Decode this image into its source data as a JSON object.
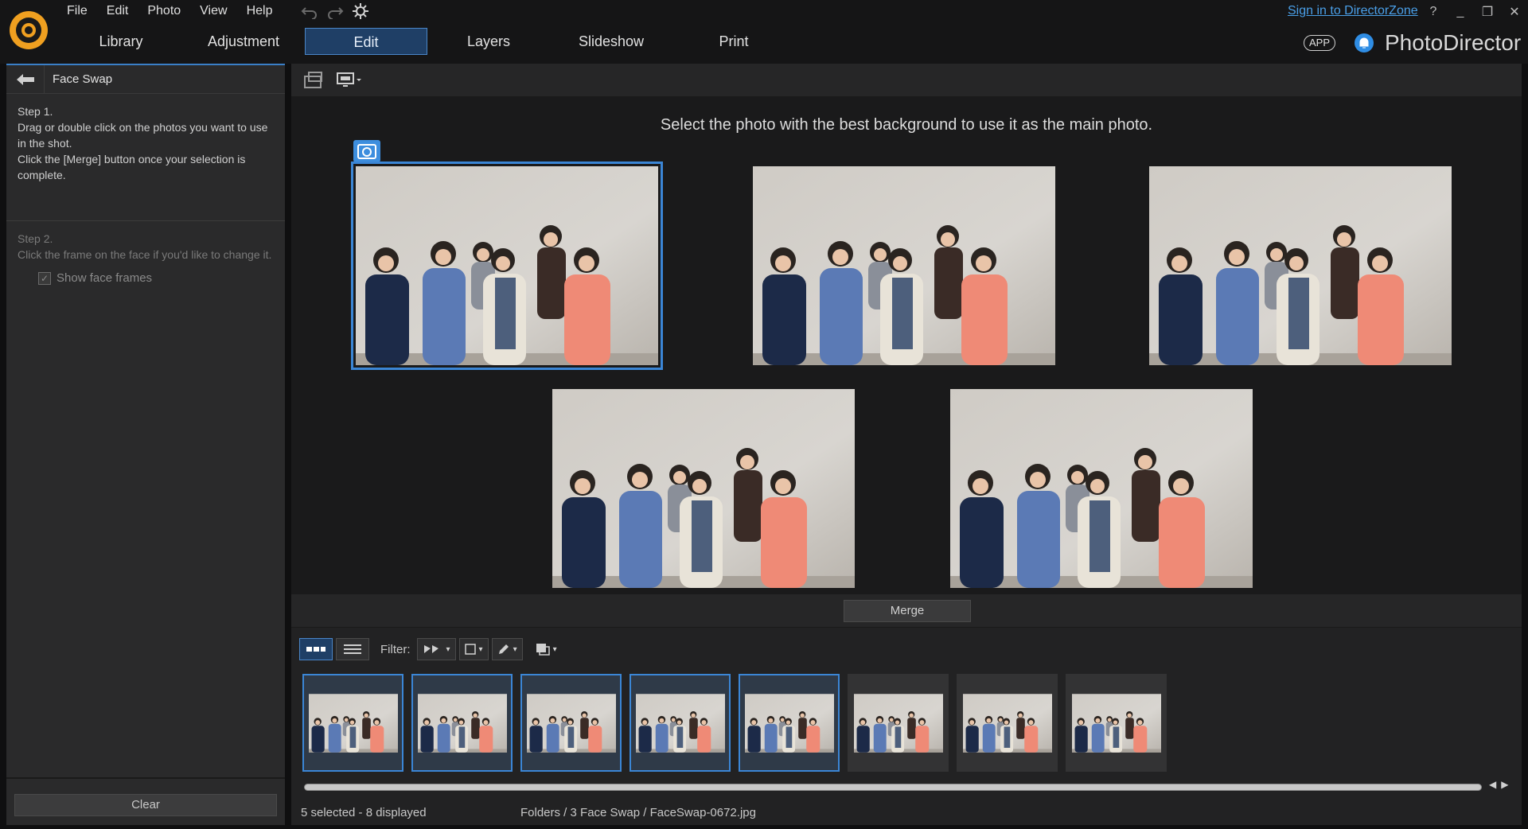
{
  "app": {
    "brand": "PhotoDirector",
    "app_badge": "APP",
    "sign_in": "Sign in to DirectorZone"
  },
  "menu": [
    "File",
    "Edit",
    "Photo",
    "View",
    "Help"
  ],
  "modes": [
    {
      "label": "Library",
      "active": false
    },
    {
      "label": "Adjustment",
      "active": false
    },
    {
      "label": "Edit",
      "active": true
    },
    {
      "label": "Layers",
      "active": false
    },
    {
      "label": "Slideshow",
      "active": false
    },
    {
      "label": "Print",
      "active": false
    }
  ],
  "window_controls": {
    "help": "?",
    "minimize": "_",
    "restore": "❐",
    "close": "✕"
  },
  "left_panel": {
    "title": "Face Swap",
    "step1_title": "Step 1.",
    "step1_text": "Drag or double click on the photos you want to use in the shot.",
    "step1_text2": "Click the [Merge] button once your selection is complete.",
    "step2_title": "Step 2.",
    "step2_text": "Click the frame on the face if you'd like to change it.",
    "show_face_frames_label": "Show face frames",
    "show_face_frames_checked": true,
    "clear_label": "Clear"
  },
  "stage": {
    "instruction": "Select the photo with the best background to use it as the main photo.",
    "photo_count": 5,
    "main_photo_index": 0
  },
  "merge_label": "Merge",
  "browser": {
    "filter_label": "Filter:",
    "thumbnails": [
      {
        "selected": true
      },
      {
        "selected": true
      },
      {
        "selected": true
      },
      {
        "selected": true
      },
      {
        "selected": true
      },
      {
        "selected": false
      },
      {
        "selected": false
      },
      {
        "selected": false
      }
    ],
    "status": "5 selected - 8 displayed",
    "path": "Folders / 3 Face Swap / FaceSwap-0672.jpg"
  },
  "colors": {
    "accent": "#3b86d6",
    "active_mode_bg": "#1f3f66",
    "link": "#4a9fe8",
    "logo_orange": "#f0a020"
  }
}
